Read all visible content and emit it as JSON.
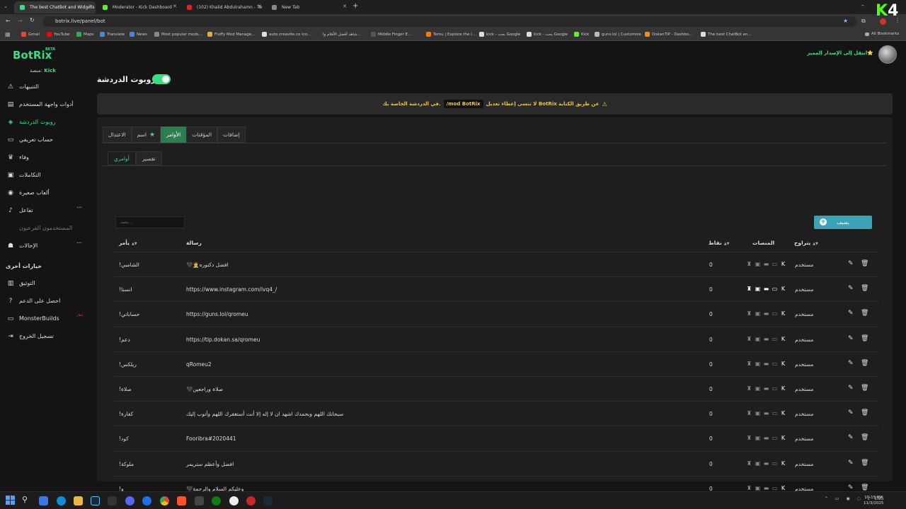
{
  "browser": {
    "tabs": [
      {
        "title": "The best ChatBot and Widgets",
        "color": "#3ddc84",
        "active": true
      },
      {
        "title": "Moderator - Kick Dashboard",
        "color": "#53fc18",
        "active": false
      },
      {
        "title": "(102) Khalid Abdulrahamn - Tw",
        "color": "#e62117",
        "active": false
      },
      {
        "title": "New Tab",
        "color": "#888888",
        "active": false
      }
    ],
    "url": "botrix.live/panel/bot",
    "bookmarks": [
      "Gmail",
      "YouTube",
      "Maps",
      "Translate",
      "News",
      "Most popular mods...",
      "Fluffy Mod Manage...",
      "auto.creavite.co ico...",
      "شاهد أفضل الأفلام وا...",
      "Middle Finger E...",
      "Temu | Explore the l...",
      "kick - بحث Google",
      "kick - بحث Google",
      "Kick",
      "guns.lol | Customize",
      "DokanTIP - Dashbo...",
      "The best ChatBot an..."
    ],
    "all_bookmarks": "All Bookmarks"
  },
  "app": {
    "logo": "BotRix",
    "beta": "BETA",
    "platform_label": "منصة:",
    "platform_value": "Kick",
    "premium_link": "انتقل إلى الإصدار المميز⭐",
    "accent": "#3ddc84"
  },
  "sidebar": {
    "items": [
      {
        "label": "التنبيهات",
        "icon": "⚠",
        "state": ""
      },
      {
        "label": "أدوات واجهة المستخدم",
        "icon": "▤",
        "state": ""
      },
      {
        "label": "روبوت الدردشة",
        "icon": "◈",
        "state": "active"
      },
      {
        "label": "حساب تعريفي",
        "icon": "▭",
        "state": ""
      },
      {
        "label": "وفاء",
        "icon": "♛",
        "state": ""
      },
      {
        "label": "التكاملات",
        "icon": "▣",
        "state": ""
      },
      {
        "label": "ألعاب صغيرة",
        "icon": "◉",
        "state": ""
      },
      {
        "label": "تفاعل",
        "icon": "♪",
        "state": "",
        "tag": "جديد"
      },
      {
        "label": "المستخدمون الفرعيون",
        "icon": "",
        "state": "disabled"
      },
      {
        "label": "الإحالات",
        "icon": "☗",
        "state": "",
        "tag": "جديد"
      }
    ],
    "section_title": "خيارات أخرى",
    "other": [
      {
        "label": "التوثيق",
        "icon": "▥"
      },
      {
        "label": "احصل على الدعم",
        "icon": "?"
      },
      {
        "label": "MonsterBuilds",
        "icon": "▭",
        "tag": "إعلان"
      },
      {
        "label": "تسجيل الخروج",
        "icon": "⇥"
      }
    ]
  },
  "main": {
    "title": "روبوت الدردشة",
    "notice_part1": "في الدردشة الخاصة بك.",
    "notice_code": "/mod BotRix",
    "notice_part2": "لا تنسى إعطاء تعديل BotRix عن طريق الكتابة",
    "tabs": [
      {
        "label": "الاعتدال",
        "active": false
      },
      {
        "label": "اسم",
        "active": false,
        "star": true
      },
      {
        "label": "الأوامر",
        "active": true
      },
      {
        "label": "المؤقتات",
        "active": false
      },
      {
        "label": "إضافات",
        "active": false
      }
    ],
    "subtabs": [
      {
        "label": "أوامري",
        "active": true
      },
      {
        "label": "تقصير",
        "active": false
      }
    ],
    "search_placeholder": "بحث...",
    "add_button": "يضيف",
    "columns": {
      "command": "يأمر",
      "message": "رسالة",
      "points": "نقاط",
      "platforms": "المنصات",
      "permission": "يتراوح"
    },
    "rows": [
      {
        "command": "!الشامبي",
        "message": "🖤🧑‍⚕️افضل دكتوره",
        "points": "0",
        "platforms_all": false,
        "permission": "مستخدم"
      },
      {
        "command": "!انستا",
        "message": "https://www.instagram.com/ivq4_/",
        "points": "0",
        "platforms_all": true,
        "permission": "مستخدم"
      },
      {
        "command": "!حساباتي",
        "message": "https://guns.lol/qromeu",
        "points": "0",
        "platforms_all": false,
        "permission": "مستخدم"
      },
      {
        "command": "!دعم",
        "message": "https://tip.dokan.sa/qromeu",
        "points": "0",
        "platforms_all": false,
        "permission": "مستخدم"
      },
      {
        "command": "!ريلكس",
        "message": "qRomeu2",
        "points": "0",
        "platforms_all": false,
        "permission": "مستخدم"
      },
      {
        "command": "!صلاة",
        "message": "🖤صلاة وراجعين",
        "points": "0",
        "platforms_all": false,
        "permission": "مستخدم"
      },
      {
        "command": "!كفارة",
        "message": "سبحانك اللهم وبحمدك اشهد ان لا إله إلا أنت أستغفرك اللهم وأتوب إليك",
        "points": "0",
        "platforms_all": false,
        "permission": "مستخدم"
      },
      {
        "command": "!كود",
        "message": "Fooribra#2020441",
        "points": "0",
        "platforms_all": false,
        "permission": "مستخدم"
      },
      {
        "command": "!ملوكة",
        "message": "افضل وأعظم ستريمر",
        "points": "0",
        "platforms_all": false,
        "permission": "مستخدم"
      },
      {
        "command": "!و",
        "message": "🖤وعليكم السلام والرحمة",
        "points": "0",
        "platforms_all": false,
        "permission": "مستخدم"
      }
    ]
  },
  "taskbar": {
    "tray": "ENG",
    "time": "10:15 PM",
    "date": "11/3/2025"
  },
  "overlay": {
    "k": "K",
    "n": "4"
  }
}
